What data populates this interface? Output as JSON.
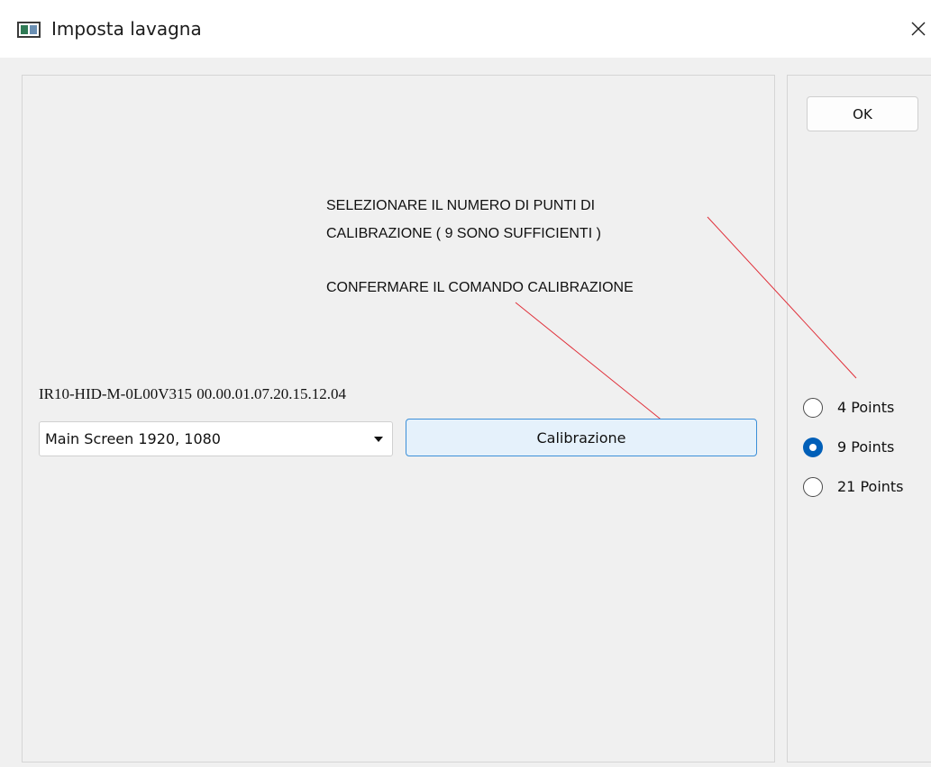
{
  "window": {
    "title": "Imposta lavagna",
    "close_icon": "close-icon",
    "app_icon": "board-app-icon"
  },
  "right_panel": {
    "ok_label": "OK",
    "calibration_points": {
      "options": [
        "4 Points",
        "9 Points",
        "21 Points"
      ],
      "selected": "9 Points"
    }
  },
  "annotations": {
    "select_points_line1": "SELEZIONARE IL NUMERO DI PUNTI DI",
    "select_points_line2": "CALIBRAZIONE ( 9 SONO SUFFICIENTI )",
    "confirm_command": "CONFERMARE IL COMANDO CALIBRAZIONE",
    "arrow_color": "#e0303a"
  },
  "main": {
    "device_info": "IR10-HID-M-0L00V315  00.00.01.07.20.15.12.04",
    "screen_select": {
      "value": "Main Screen 1920, 1080"
    },
    "calibrate_label": "Calibrazione"
  },
  "colors": {
    "accent": "#005fb8",
    "button_highlight_bg": "#e5f1fb",
    "button_highlight_border": "#3c8fd8",
    "window_bg": "#f0f0f0"
  }
}
